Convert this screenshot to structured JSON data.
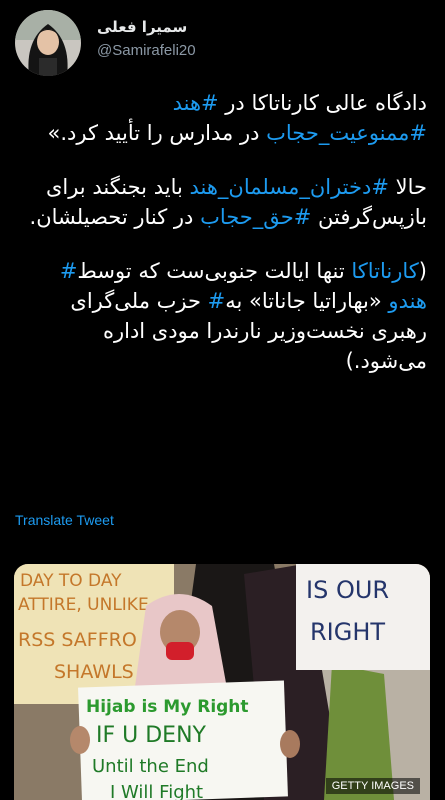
{
  "author": {
    "display_name": "سمیرا فعلی",
    "handle": "@Samirafeli20"
  },
  "tweet": {
    "p1": {
      "t1": "دادگاه عالی کارناتاکا در ",
      "tag1": "#هند",
      "tag2": "#ممنوعیت_حجاب",
      "t2": " در مدارس را تأیید کرد.»"
    },
    "p2": {
      "t1": "حالا ",
      "tag1": "#دختران_مسلمان_هند",
      "t2": " باید بجنگند برای بازپس‌گرفتن ",
      "tag2": "#حق_حجاب",
      "t3": " در کنار تحصیلشان."
    },
    "p3": {
      "t1": "(",
      "tag1": "کارناتاکا",
      "t2": " تنها ایالت جنوبی‌ست که توسط",
      "tag2": "#",
      "tag3": " هندو",
      "t3": " «بهاراتیا جاناتا» به",
      "tag4": "#",
      "t4": " حزب ملی‌گرای رهبری نخست‌وزیر نارندرا مودی اداره می‌شود.)"
    }
  },
  "translate_label": "Translate Tweet",
  "media": {
    "sign_left": [
      "DAY TO DAY",
      "ATTIRE, UNLIKE",
      "RSS SAFFRO",
      "SHAWLS"
    ],
    "sign_right": [
      "IS OUR",
      "RIGHT"
    ],
    "sign_center": [
      "Hijab is My Right",
      "IF U DENY",
      "Until the End",
      "I Will Fight"
    ],
    "watermark": "GETTY IMAGES"
  },
  "colors": {
    "background": "#000000",
    "text": "#ffffff",
    "link": "#1d9bf0",
    "muted": "#8b98a5"
  }
}
